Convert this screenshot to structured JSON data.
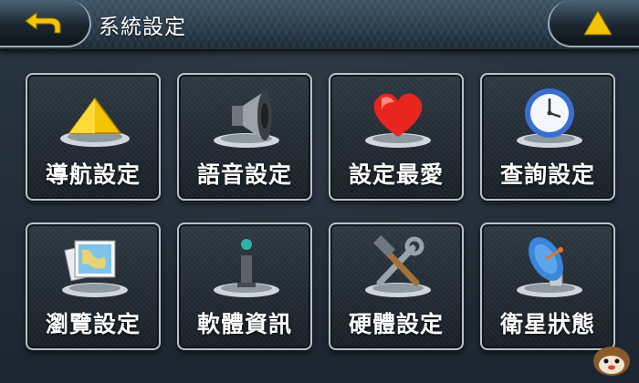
{
  "header": {
    "title": "系統設定",
    "back_icon": "back-arrow-icon",
    "up_icon": "up-triangle-icon"
  },
  "menu": {
    "items": [
      {
        "label": "導航設定",
        "icon": "navigation-arrow-icon"
      },
      {
        "label": "語音設定",
        "icon": "speaker-icon"
      },
      {
        "label": "設定最愛",
        "icon": "heart-icon"
      },
      {
        "label": "查詢設定",
        "icon": "clock-icon"
      },
      {
        "label": "瀏覽設定",
        "icon": "map-photos-icon"
      },
      {
        "label": "軟體資訊",
        "icon": "info-icon"
      },
      {
        "label": "硬體設定",
        "icon": "tools-icon"
      },
      {
        "label": "衛星狀態",
        "icon": "satellite-dish-icon"
      }
    ]
  },
  "colors": {
    "accent_yellow": "#f5c400",
    "heart_red": "#e8251f",
    "clock_blue": "#3a6fd0",
    "tile_border": "#b9c2c9",
    "background": "#24303c"
  }
}
